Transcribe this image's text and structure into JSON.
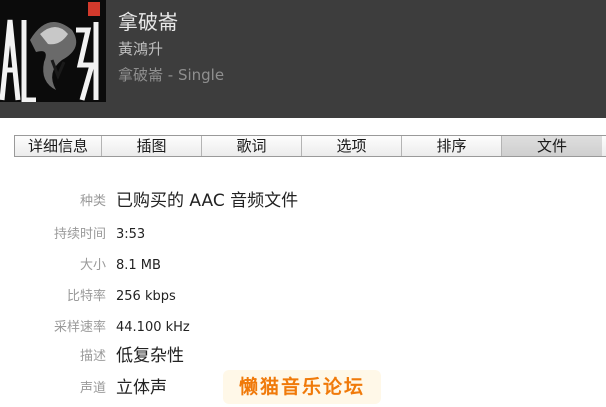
{
  "track": {
    "title": "拿破崙",
    "artist": "黃鴻升",
    "album": "拿破崙 - Single"
  },
  "tabs": [
    {
      "label": "详细信息",
      "active": false
    },
    {
      "label": "插图",
      "active": false
    },
    {
      "label": "歌词",
      "active": false
    },
    {
      "label": "选项",
      "active": false
    },
    {
      "label": "排序",
      "active": false
    },
    {
      "label": "文件",
      "active": true
    }
  ],
  "file_info": {
    "kind_label": "种类",
    "kind_value": "已购买的 AAC 音频文件",
    "duration_label": "持续时间",
    "duration_value": "3:53",
    "size_label": "大小",
    "size_value": "8.1 MB",
    "bitrate_label": "比特率",
    "bitrate_value": "256 kbps",
    "samplerate_label": "采样速率",
    "samplerate_value": "44.100 kHz",
    "description_label": "描述",
    "description_value": "低复杂性",
    "channels_label": "声道",
    "channels_value": "立体声"
  },
  "watermark": "懒猫音乐论坛",
  "colors": {
    "header_bg": "#3d3d3d",
    "label_gray": "#9a9a9a",
    "watermark_orange": "#f07a0a"
  }
}
